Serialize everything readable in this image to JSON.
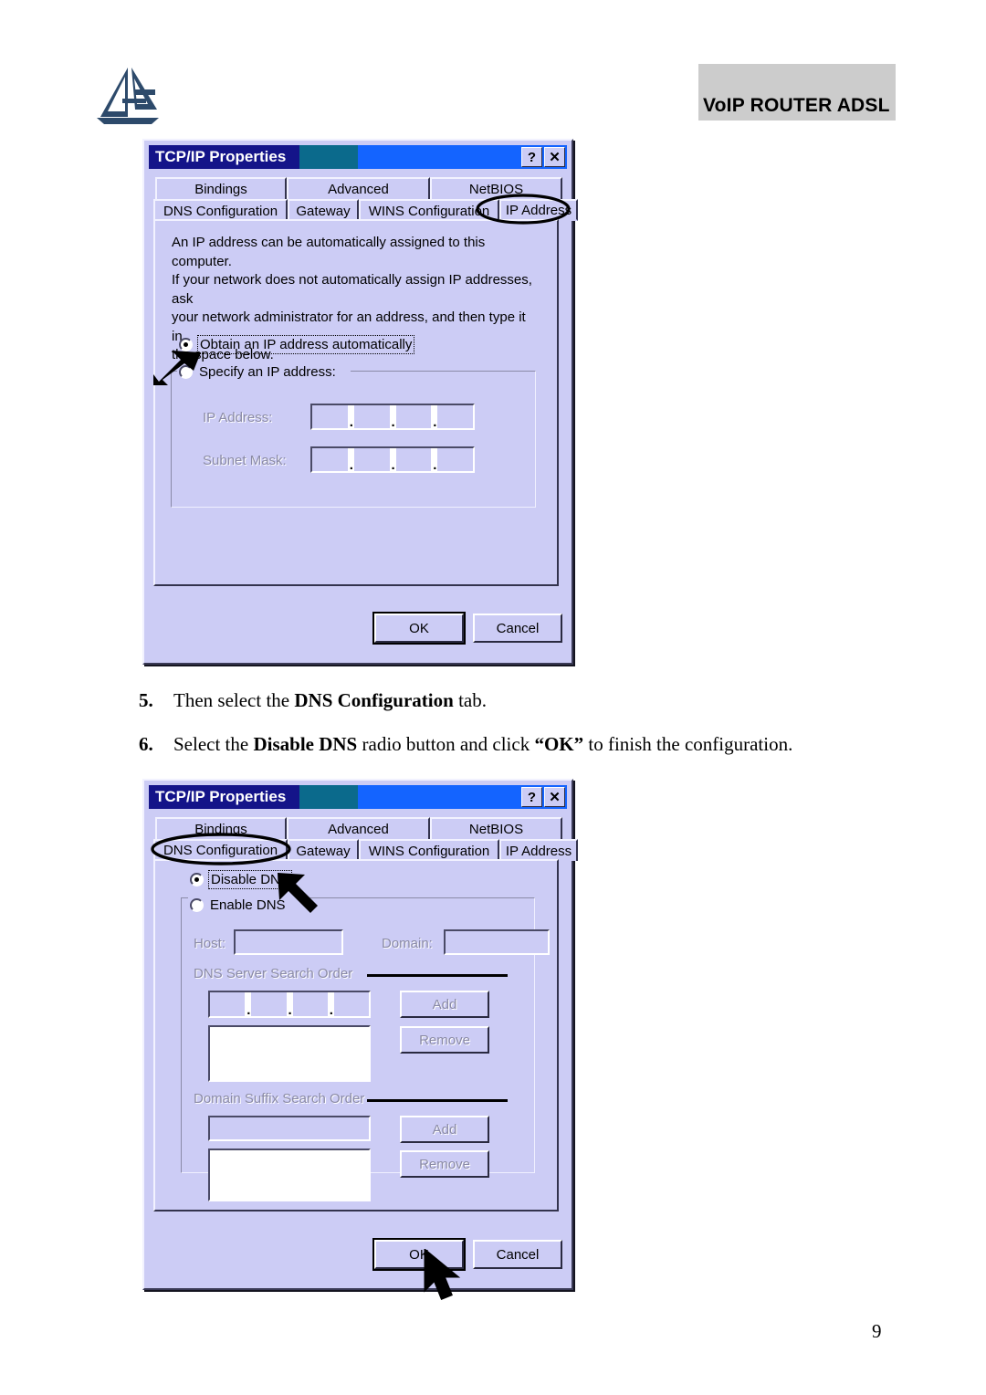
{
  "header": {
    "logo_alt": "Atlantis Land logo",
    "product_band": "VoIP ROUTER ADSL"
  },
  "dialog_ip": {
    "title": "TCP/IP Properties",
    "help_button": "?",
    "close_button": "✕",
    "tabs_row1": [
      {
        "label": "Bindings",
        "active": false
      },
      {
        "label": "Advanced",
        "active": false
      },
      {
        "label": "NetBIOS",
        "active": false
      }
    ],
    "tabs_row2": [
      {
        "label": "DNS Configuration",
        "active": false
      },
      {
        "label": "Gateway",
        "active": false
      },
      {
        "label": "WINS Configuration",
        "active": false
      },
      {
        "label": "IP Address",
        "active": true
      }
    ],
    "circled_tab": "IP Address",
    "description": "An IP address can be automatically assigned to this computer.\nIf your network does not automatically assign IP addresses, ask\nyour network administrator for an address, and then type it in\nthe space below.",
    "radio_obtain": "Obtain an IP address automatically",
    "radio_specify": "Specify an IP address:",
    "selected_radio": "Obtain an IP address automatically",
    "label_ip_address": "IP Address:",
    "label_subnet_mask": "Subnet Mask:",
    "ip_address_value": "",
    "subnet_mask_value": "",
    "ok_label": "OK",
    "cancel_label": "Cancel"
  },
  "steps": [
    {
      "number": "5.",
      "parts": [
        {
          "text": "Then select the ",
          "bold": false
        },
        {
          "text": "DNS Configuration",
          "bold": true
        },
        {
          "text": " tab.",
          "bold": false
        }
      ]
    },
    {
      "number": "6.",
      "parts": [
        {
          "text": "Select the ",
          "bold": false
        },
        {
          "text": "Disable DNS",
          "bold": true
        },
        {
          "text": " radio button and click ",
          "bold": false
        },
        {
          "text": "“OK”",
          "bold": true
        },
        {
          "text": " to finish the configuration.",
          "bold": false
        }
      ]
    }
  ],
  "dialog_dns": {
    "title": "TCP/IP Properties",
    "help_button": "?",
    "close_button": "✕",
    "tabs_row1": [
      {
        "label": "Bindings",
        "active": false
      },
      {
        "label": "Advanced",
        "active": false
      },
      {
        "label": "NetBIOS",
        "active": false
      }
    ],
    "tabs_row2": [
      {
        "label": "DNS Configuration",
        "active": true
      },
      {
        "label": "Gateway",
        "active": false
      },
      {
        "label": "WINS Configuration",
        "active": false
      },
      {
        "label": "IP Address",
        "active": false
      }
    ],
    "circled_tab": "DNS Configuration",
    "radio_disable": "Disable DNS",
    "radio_enable": "Enable DNS",
    "selected_radio": "Disable DNS",
    "label_host": "Host:",
    "label_domain": "Domain:",
    "host_value": "",
    "domain_value": "",
    "section_dns_search": "DNS Server Search Order",
    "dns_entry_value": "",
    "dns_list_items": [],
    "dns_add_label": "Add",
    "dns_remove_label": "Remove",
    "section_domain_suffix": "Domain Suffix Search Order",
    "suffix_entry_value": "",
    "suffix_list_items": [],
    "suffix_add_label": "Add",
    "suffix_remove_label": "Remove",
    "ok_label": "OK",
    "cancel_label": "Cancel"
  },
  "footer": {
    "page_number": "9"
  }
}
